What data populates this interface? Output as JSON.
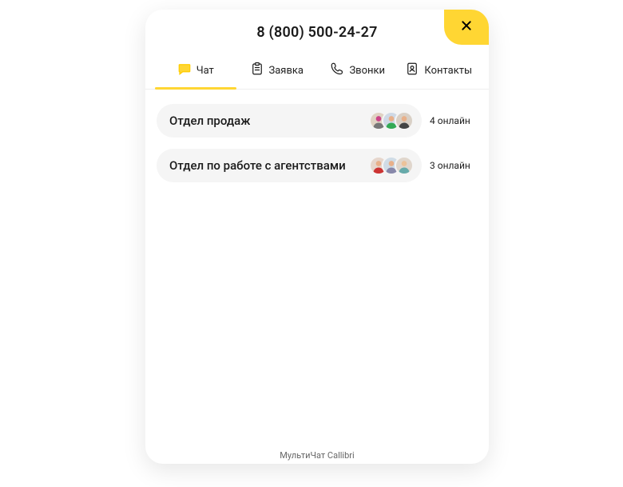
{
  "header": {
    "phone": "8 (800) 500-24-27"
  },
  "tabs": [
    {
      "key": "chat",
      "label": "Чат",
      "icon": "chat-icon",
      "active": true
    },
    {
      "key": "request",
      "label": "Заявка",
      "icon": "form-icon",
      "active": false
    },
    {
      "key": "calls",
      "label": "Звонки",
      "icon": "phone-icon",
      "active": false
    },
    {
      "key": "contacts",
      "label": "Контакты",
      "icon": "contact-icon",
      "active": false
    }
  ],
  "departments": [
    {
      "name": "Отдел продаж",
      "online_text": "4 онлайн",
      "avatars": 3
    },
    {
      "name": "Отдел по работе с агентствами",
      "online_text": "3 онлайн",
      "avatars": 3
    }
  ],
  "footer": {
    "text": "МультиЧат Callibri"
  }
}
